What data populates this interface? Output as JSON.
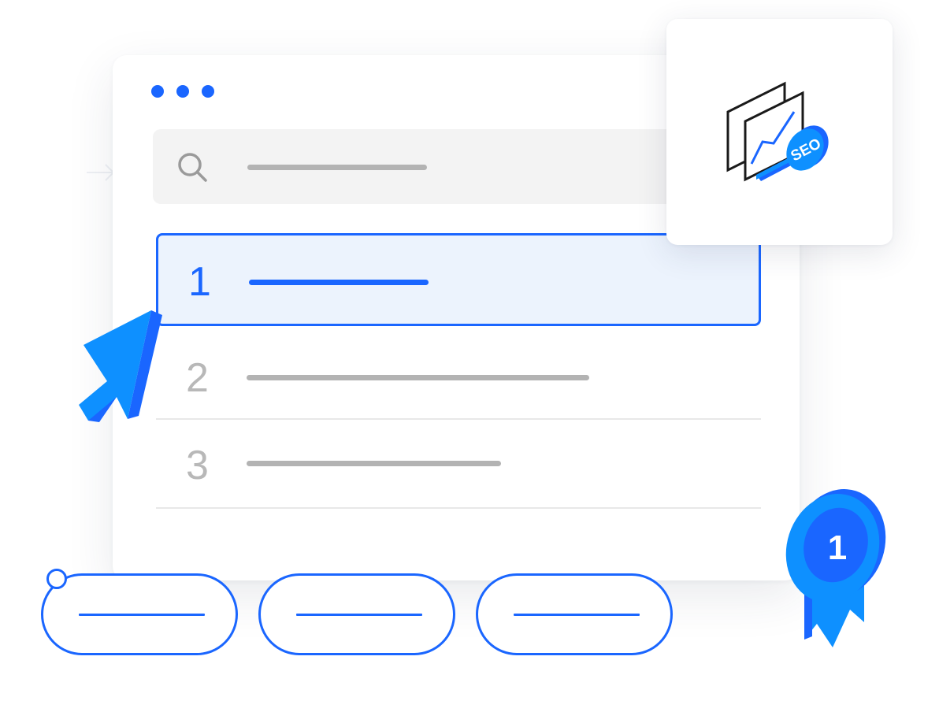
{
  "window": {
    "dots": [
      "dot",
      "dot",
      "dot"
    ]
  },
  "search": {
    "icon": "search-icon"
  },
  "results": [
    {
      "rank": "1",
      "selected": true
    },
    {
      "rank": "2",
      "selected": false
    },
    {
      "rank": "3",
      "selected": false
    }
  ],
  "seo_badge": {
    "icon": "seo-chart-magnifier-icon",
    "label": "SEO"
  },
  "medal": {
    "icon": "first-place-medal-icon",
    "label": "1"
  },
  "cursor": {
    "icon": "mouse-pointer-icon"
  },
  "pills": {
    "count": 3
  },
  "colors": {
    "accent": "#1a66ff",
    "accent_light": "#0e90ff",
    "selected_bg": "#ecf3fd",
    "placeholder_line": "#b3b3b3",
    "search_bg": "#f3f3f3",
    "muted_number": "#b8b8b8"
  }
}
